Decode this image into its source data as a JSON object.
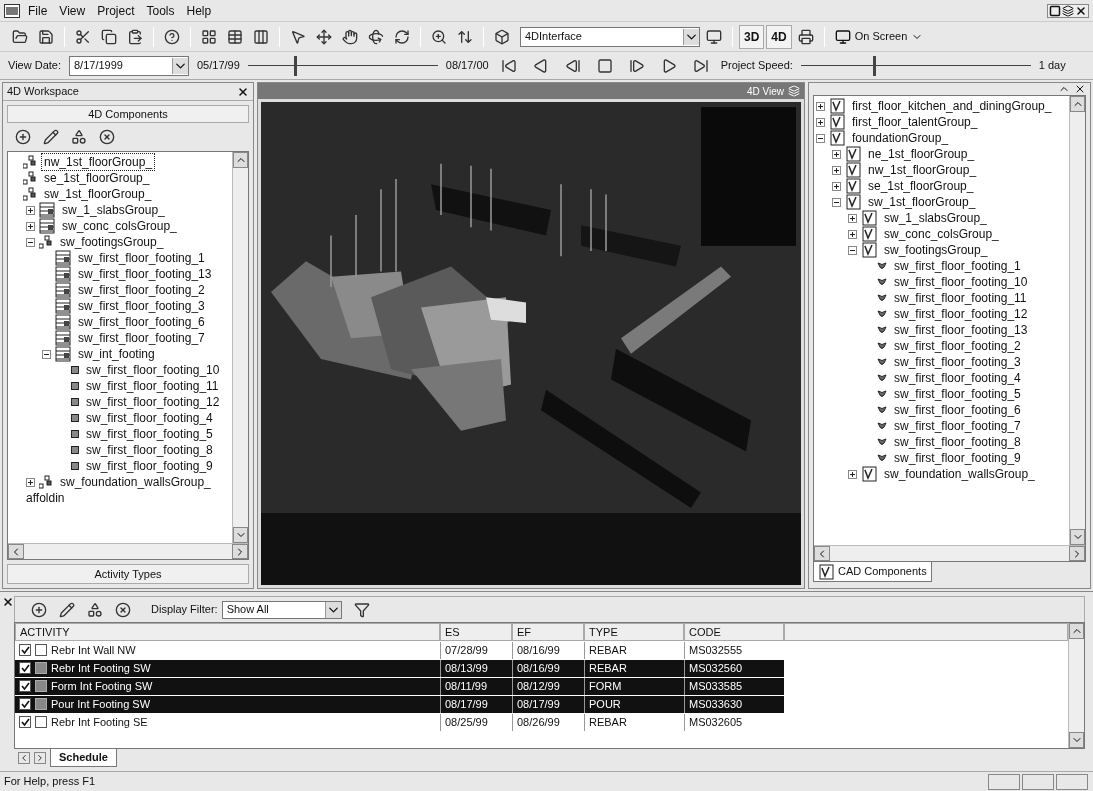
{
  "menu": [
    {
      "label": "File"
    },
    {
      "label": "View"
    },
    {
      "label": "Project"
    },
    {
      "label": "Tools"
    },
    {
      "label": "Help"
    }
  ],
  "toolbar": {
    "view_combo": "4DInterface",
    "mode_buttons": [
      "3D",
      "4D"
    ],
    "output_button": "On Screen"
  },
  "date_bar": {
    "view_date_label": "View Date:",
    "view_date": "8/17/1999",
    "start": "05/17/99",
    "end": "08/17/00",
    "timeline": {
      "level": 0.25
    },
    "speed_label": "Project Speed:",
    "speed": {
      "level": 0.32
    },
    "speed_value": "1 day"
  },
  "left_panel": {
    "title": "4D Workspace",
    "tab": "4D Components",
    "bottom_tab": "Activity Types",
    "tree": [
      {
        "label": "nw_1st_floorGroup_",
        "kind": "group",
        "selected": true
      },
      {
        "label": "se_1st_floorGroup_",
        "kind": "group",
        "selected": false
      },
      {
        "label": "sw_1st_floorGroup_",
        "kind": "group",
        "selected": false,
        "children": [
          {
            "label": "sw_1_slabsGroup_",
            "kind": "table",
            "expanded": false,
            "selected": false
          },
          {
            "label": "sw_conc_colsGroup_",
            "kind": "table",
            "expanded": false,
            "selected": false
          },
          {
            "label": "sw_footingsGroup_",
            "kind": "group",
            "expanded": true,
            "selected": false,
            "children": [
              {
                "label": "sw_first_floor_footing_1",
                "kind": "table",
                "selected": false
              },
              {
                "label": "sw_first_floor_footing_13",
                "kind": "table",
                "selected": false
              },
              {
                "label": "sw_first_floor_footing_2",
                "kind": "table",
                "selected": false
              },
              {
                "label": "sw_first_floor_footing_3",
                "kind": "table",
                "selected": false
              },
              {
                "label": "sw_first_floor_footing_6",
                "kind": "table",
                "selected": false
              },
              {
                "label": "sw_first_floor_footing_7",
                "kind": "table",
                "selected": false
              },
              {
                "label": "sw_int_footing",
                "kind": "table",
                "expanded": true,
                "selected": false,
                "children": [
                  {
                    "label": "sw_first_floor_footing_10",
                    "kind": "item",
                    "selected": false
                  },
                  {
                    "label": "sw_first_floor_footing_11",
                    "kind": "item",
                    "selected": false
                  },
                  {
                    "label": "sw_first_floor_footing_12",
                    "kind": "item",
                    "selected": false
                  },
                  {
                    "label": "sw_first_floor_footing_4",
                    "kind": "item",
                    "selected": false
                  },
                  {
                    "label": "sw_first_floor_footing_5",
                    "kind": "item",
                    "selected": false
                  },
                  {
                    "label": "sw_first_floor_footing_8",
                    "kind": "item",
                    "selected": false
                  },
                  {
                    "label": "sw_first_floor_footing_9",
                    "kind": "item",
                    "selected": false
                  }
                ]
              }
            ]
          },
          {
            "label": "sw_foundation_wallsGroup_",
            "kind": "group",
            "expanded": false,
            "selected": false
          }
        ]
      },
      {
        "label": "affoldin",
        "kind": "plain",
        "selected": false
      }
    ]
  },
  "view": {
    "title": "4D View"
  },
  "right_panel": {
    "bottom_tab": "CAD Components",
    "tree": [
      {
        "label": "first_floor_kitchen_and_diningGroup_",
        "kind": "cad",
        "expanded": false
      },
      {
        "label": "first_floor_talentGroup_",
        "kind": "cad",
        "expanded": false
      },
      {
        "label": "foundationGroup_",
        "kind": "cad",
        "expanded": true,
        "children": [
          {
            "label": "ne_1st_floorGroup_",
            "kind": "cad",
            "expanded": false
          },
          {
            "label": "nw_1st_floorGroup_",
            "kind": "cad",
            "expanded": false
          },
          {
            "label": "se_1st_floorGroup_",
            "kind": "cad",
            "expanded": false
          },
          {
            "label": "sw_1st_floorGroup_",
            "kind": "cad",
            "expanded": true,
            "children": [
              {
                "label": "sw_1_slabsGroup_",
                "kind": "cad",
                "expanded": false
              },
              {
                "label": "sw_conc_colsGroup_",
                "kind": "cad",
                "expanded": false
              },
              {
                "label": "sw_footingsGroup_",
                "kind": "cad",
                "expanded": true,
                "children": [
                  {
                    "label": "sw_first_floor_footing_1",
                    "kind": "part"
                  },
                  {
                    "label": "sw_first_floor_footing_10",
                    "kind": "part"
                  },
                  {
                    "label": "sw_first_floor_footing_11",
                    "kind": "part"
                  },
                  {
                    "label": "sw_first_floor_footing_12",
                    "kind": "part"
                  },
                  {
                    "label": "sw_first_floor_footing_13",
                    "kind": "part"
                  },
                  {
                    "label": "sw_first_floor_footing_2",
                    "kind": "part"
                  },
                  {
                    "label": "sw_first_floor_footing_3",
                    "kind": "part"
                  },
                  {
                    "label": "sw_first_floor_footing_4",
                    "kind": "part"
                  },
                  {
                    "label": "sw_first_floor_footing_5",
                    "kind": "part"
                  },
                  {
                    "label": "sw_first_floor_footing_6",
                    "kind": "part"
                  },
                  {
                    "label": "sw_first_floor_footing_7",
                    "kind": "part"
                  },
                  {
                    "label": "sw_first_floor_footing_8",
                    "kind": "part"
                  },
                  {
                    "label": "sw_first_floor_footing_9",
                    "kind": "part"
                  }
                ]
              },
              {
                "label": "sw_foundation_wallsGroup_",
                "kind": "cad",
                "expanded": false
              }
            ]
          }
        ]
      }
    ]
  },
  "schedule": {
    "filter_label": "Display Filter:",
    "filter_value": "Show All",
    "columns": [
      "ACTIVITY",
      "ES",
      "EF",
      "TYPE",
      "CODE"
    ],
    "rows": [
      {
        "activity": "Rebr Int Wall NW",
        "es": "07/28/99",
        "ef": "08/16/99",
        "type": "REBAR",
        "code": "MS032555",
        "checked": true,
        "selected": false
      },
      {
        "activity": "Rebr Int Footing SW",
        "es": "08/13/99",
        "ef": "08/16/99",
        "type": "REBAR",
        "code": "MS032560",
        "checked": true,
        "selected": true
      },
      {
        "activity": "Form Int Footing SW",
        "es": "08/11/99",
        "ef": "08/12/99",
        "type": "FORM",
        "code": "MS033585",
        "checked": true,
        "selected": true
      },
      {
        "activity": "Pour Int Footing SW",
        "es": "08/17/99",
        "ef": "08/17/99",
        "type": "POUR",
        "code": "MS033630",
        "checked": true,
        "selected": true
      },
      {
        "activity": "Rebr Int Footing SE",
        "es": "08/25/99",
        "ef": "08/26/99",
        "type": "REBAR",
        "code": "MS032605",
        "checked": true,
        "selected": false
      }
    ],
    "tab": "Schedule"
  },
  "status_bar": {
    "text": "For Help, press F1"
  }
}
